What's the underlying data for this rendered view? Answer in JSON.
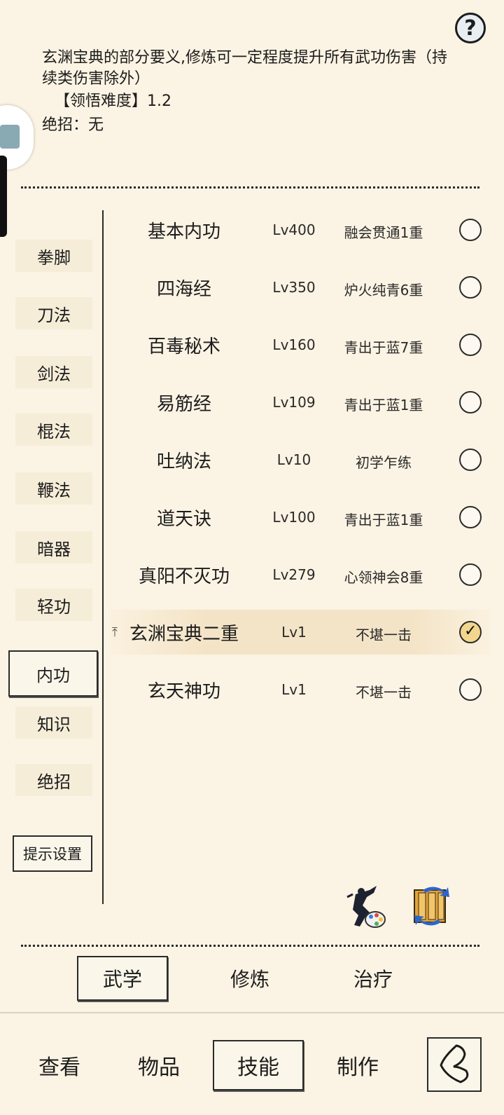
{
  "help": {
    "label": "?"
  },
  "description": {
    "text": "玄渊宝典的部分要义,修炼可一定程度提升所有武功伤害（持续类伤害除外）",
    "difficulty": "【领悟难度】1.2",
    "ultimate": "绝招：无"
  },
  "categories": [
    {
      "label": "拳脚"
    },
    {
      "label": "刀法"
    },
    {
      "label": "剑法"
    },
    {
      "label": "棍法"
    },
    {
      "label": "鞭法"
    },
    {
      "label": "暗器"
    },
    {
      "label": "轻功"
    },
    {
      "label": "内功"
    },
    {
      "label": "知识"
    },
    {
      "label": "绝招"
    }
  ],
  "active_category": "内功",
  "hint_button": "提示设置",
  "skills": [
    {
      "name": "基本内功",
      "level": "Lv400",
      "rank": "融会贯通1重",
      "selected": false
    },
    {
      "name": "四海经",
      "level": "Lv350",
      "rank": "炉火纯青6重",
      "selected": false
    },
    {
      "name": "百毒秘术",
      "level": "Lv160",
      "rank": "青出于蓝7重",
      "selected": false
    },
    {
      "name": "易筋经",
      "level": "Lv109",
      "rank": "青出于蓝1重",
      "selected": false
    },
    {
      "name": "吐纳法",
      "level": "Lv10",
      "rank": "初学乍练",
      "selected": false
    },
    {
      "name": "道天诀",
      "level": "Lv100",
      "rank": "青出于蓝1重",
      "selected": false
    },
    {
      "name": "真阳不灭功",
      "level": "Lv279",
      "rank": "心领神会8重",
      "selected": false
    },
    {
      "name": "玄渊宝典二重",
      "level": "Lv1",
      "rank": "不堪一击",
      "selected": true,
      "upgrade": true
    },
    {
      "name": "玄天神功",
      "level": "Lv1",
      "rank": "不堪一击",
      "selected": false
    }
  ],
  "subtabs": [
    {
      "label": "武学"
    },
    {
      "label": "修炼"
    },
    {
      "label": "治疗"
    }
  ],
  "active_subtab": "武学",
  "nav": [
    {
      "label": "查看"
    },
    {
      "label": "物品"
    },
    {
      "label": "技能"
    },
    {
      "label": "制作"
    }
  ],
  "active_nav": "技能",
  "colors": {
    "background": "#fbf3e3",
    "selected_row": "#f4e4c7",
    "ink": "#1c1c1c"
  }
}
